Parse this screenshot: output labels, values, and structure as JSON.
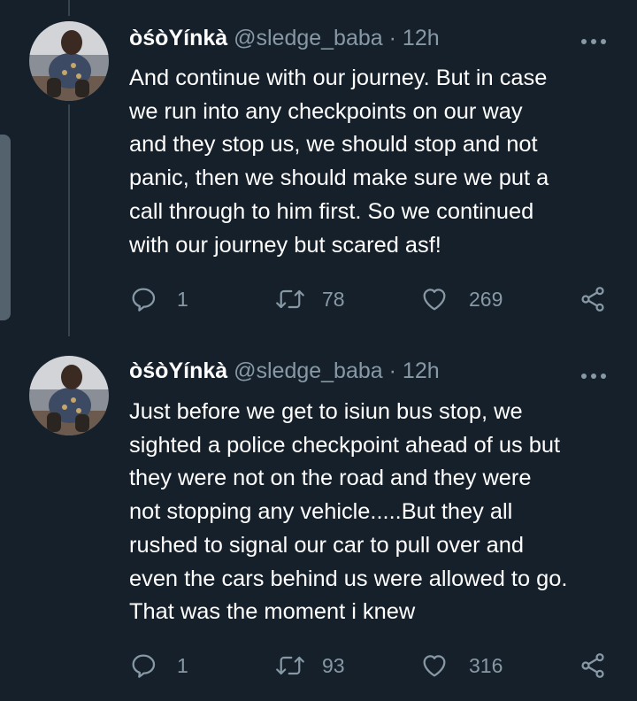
{
  "tweets": [
    {
      "author_name": "òśòYínkà",
      "handle": "@sledge_baba",
      "separator": "·",
      "time": "12h",
      "lines": [
        "And continue with our journey. But in case",
        "we run into any checkpoints on our way",
        "and they stop us, we should stop and not",
        "panic, then we should make sure we put a",
        "call through to him first. So we continued",
        "with our journey but scared asf!"
      ],
      "replies": "1",
      "retweets": "78",
      "likes": "269"
    },
    {
      "author_name": "òśòYínkà",
      "handle": "@sledge_baba",
      "separator": "·",
      "time": "12h",
      "lines": [
        "Just before we get to isiun bus stop, we",
        "sighted a police checkpoint ahead of us but",
        "they were not on the road and they were",
        "not stopping any vehicle.....But they all",
        "rushed to signal our car to pull over and",
        "even the cars behind us were allowed to go.",
        "That was the moment i knew"
      ],
      "replies": "1",
      "retweets": "93",
      "likes": "316"
    }
  ],
  "colors": {
    "background": "#15202b",
    "text": "#ffffff",
    "secondary_text": "#8899a6",
    "thread_line": "#38444d"
  },
  "icons": [
    "reply-icon",
    "retweet-icon",
    "like-icon",
    "share-icon",
    "more-icon"
  ]
}
